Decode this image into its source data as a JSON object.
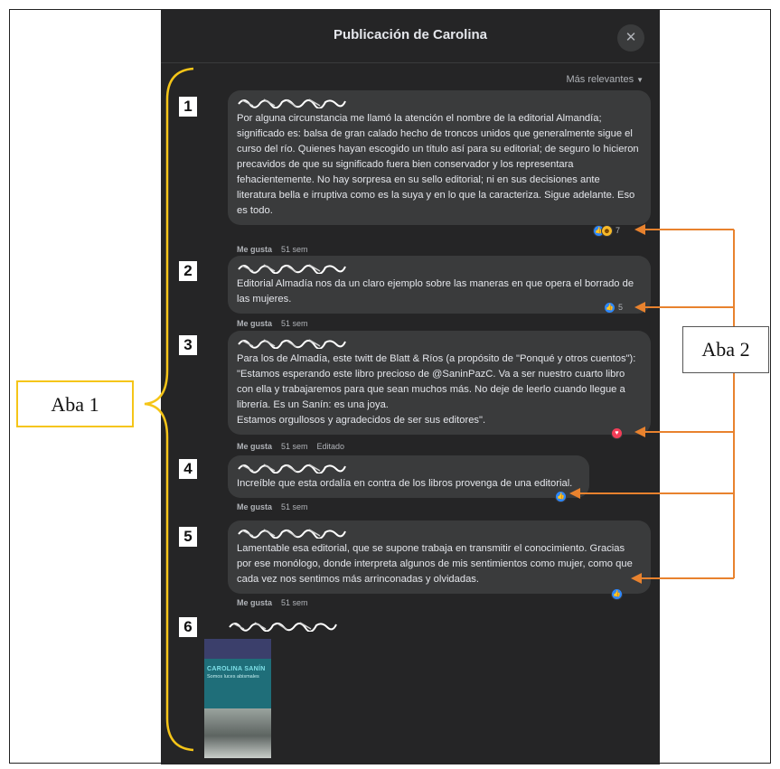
{
  "dialog": {
    "title": "Publicación de Carolina",
    "close_icon": "close-icon",
    "sort_label": "Más relevantes",
    "sort_icon": "caret-down-icon"
  },
  "comments": [
    {
      "number": "1",
      "text": "Por alguna circunstancia me llamó la atención el nombre de la editorial Almandía; significado es: balsa de gran calado hecho de troncos unidos que generalmente sigue el curso del río. Quienes hayan escogido un título así para su editorial; de seguro lo hicieron precavidos de que su significado fuera bien conservador y los representara fehacientemente. No hay sorpresa en su sello editorial; ni en sus decisiones ante literatura bella e irruptiva como es la suya y en lo que la caracteriza. Sigue adelante. Eso es todo.",
      "like_label": "Me gusta",
      "time": "51 sem",
      "reactions": [
        "like",
        "haha"
      ],
      "reaction_count": "7"
    },
    {
      "number": "2",
      "text": "Editorial Almadía nos da un claro ejemplo sobre las maneras en que opera el borrado de las mujeres.",
      "like_label": "Me gusta",
      "time": "51 sem",
      "reactions": [
        "like"
      ],
      "reaction_count": "5"
    },
    {
      "number": "3",
      "text_lines": [
        "Para los de Almadía, este twitt de Blatt & Ríos (a propósito de \"Ponqué y otros cuentos\"): \"Estamos esperando este libro precioso de @SaninPazC. Va a ser nuestro cuarto libro con ella y trabajaremos para que sean muchos más. No deje de leerlo cuando llegue a librería. Es un Sanín: es una joya.",
        "Estamos orgullosos y agradecidos de ser sus editores\"."
      ],
      "like_label": "Me gusta",
      "time": "51 sem",
      "edited": "Editado",
      "reactions": [
        "love"
      ]
    },
    {
      "number": "4",
      "text": "Increíble que esta ordalía en contra de los libros provenga de una editorial.",
      "like_label": "Me gusta",
      "time": "51 sem",
      "reactions": [
        "like"
      ]
    },
    {
      "number": "5",
      "text": "Lamentable esa editorial, que se supone trabaja en transmitir el conocimiento. Gracias por ese monólogo, donde interpreta algunos de mis sentimientos como mujer, como que cada vez nos sentimos más arrinconadas y olvidadas.",
      "like_label": "Me gusta",
      "time": "51 sem",
      "reactions": [
        "like"
      ]
    },
    {
      "number": "6",
      "image_title": "CAROLINA SANÍN",
      "image_subtitle": "Somos luces abismales"
    }
  ],
  "annotations": {
    "aba1_label": "Aba 1",
    "aba2_label": "Aba 2",
    "aba1_color": "#f5c518",
    "aba2_color": "#e8822e"
  }
}
